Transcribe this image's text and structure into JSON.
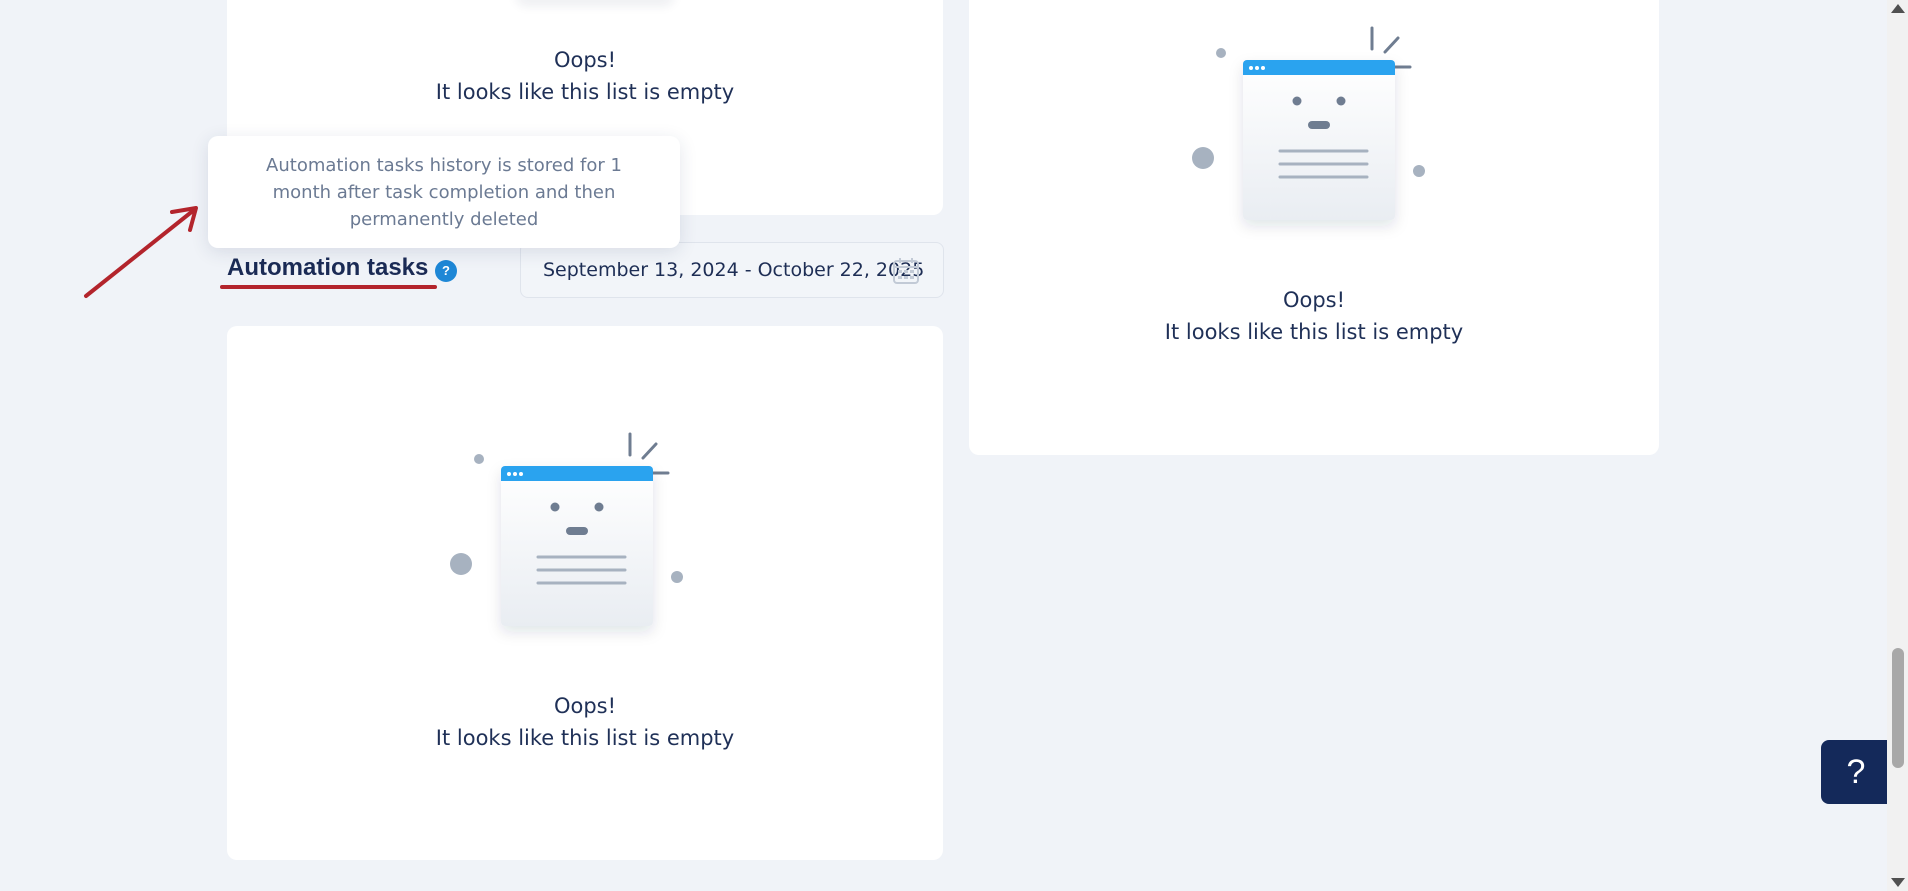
{
  "empty_states": {
    "top_left": {
      "line1": "Oops!",
      "line2": "It looks like this list is empty"
    },
    "right": {
      "line1": "Oops!",
      "line2": "It looks like this list is empty"
    },
    "bottom": {
      "line1": "Oops!",
      "line2": "It looks like this list is empty"
    }
  },
  "automation": {
    "title": "Automation tasks",
    "help_glyph": "?",
    "date_range": "September 13, 2024 - October 22, 2025",
    "tooltip": "Automation tasks history is stored for 1 month after task completion and then permanently deleted"
  },
  "help_button": {
    "label": "?"
  },
  "icons": {
    "help": "question-circle-icon",
    "calendar": "calendar-icon",
    "empty": "empty-list-illustration",
    "annotation": "red-arrow-annotation"
  },
  "colors": {
    "background": "#f0f3f8",
    "card": "#ffffff",
    "text": "#1d2d4f",
    "accent_blue": "#1e87d6",
    "annotation_red": "#b3242c",
    "help_fab": "#14295a"
  }
}
